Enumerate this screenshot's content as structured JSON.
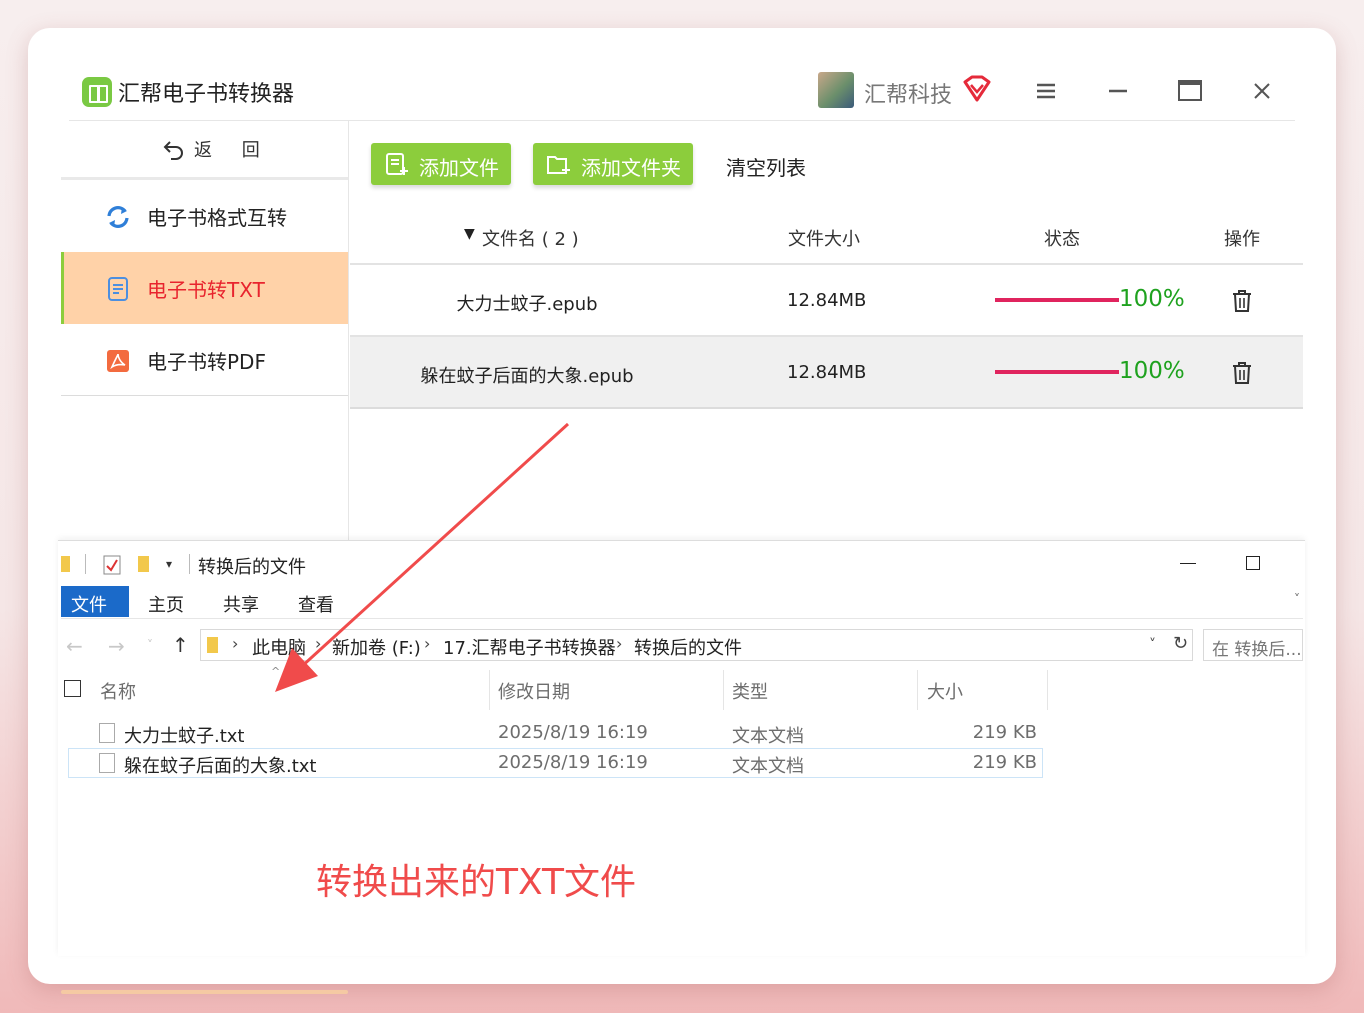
{
  "app": {
    "title": "汇帮电子书转换器",
    "user_name": "汇帮科技",
    "accent_green": "#8ccd3c",
    "brand_red": "#e0245e"
  },
  "sidebar": {
    "back_label": "返 回",
    "items": [
      {
        "label": "电子书格式互转",
        "icon": "refresh-icon",
        "active": false
      },
      {
        "label": "电子书转TXT",
        "icon": "document-icon",
        "active": true
      },
      {
        "label": "电子书转PDF",
        "icon": "pdf-icon",
        "active": false
      }
    ]
  },
  "toolbar": {
    "add_file": "添加文件",
    "add_folder": "添加文件夹",
    "clear_list": "清空列表"
  },
  "table": {
    "headers": {
      "name": "文件名 ( 2 )",
      "size": "文件大小",
      "status": "状态",
      "action": "操作"
    },
    "rows": [
      {
        "name": "大力士蚊子.epub",
        "size": "12.84MB",
        "progress": 1.0,
        "progress_label": "100%"
      },
      {
        "name": "躲在蚊子后面的大象.epub",
        "size": "12.84MB",
        "progress": 1.0,
        "progress_label": "100%"
      }
    ]
  },
  "explorer": {
    "window_title": "转换后的文件",
    "ribbon_tabs": [
      "文件",
      "主页",
      "共享",
      "查看"
    ],
    "path": [
      "此电脑",
      "新加卷 (F:)",
      "17.汇帮电子书转换器",
      "转换后的文件"
    ],
    "search_placeholder": "在 转换后...",
    "columns": {
      "name": "名称",
      "modified": "修改日期",
      "type": "类型",
      "size": "大小"
    },
    "files": [
      {
        "name": "大力士蚊子.txt",
        "modified": "2025/8/19 16:19",
        "type": "文本文档",
        "size": "219 KB"
      },
      {
        "name": "躲在蚊子后面的大象.txt",
        "modified": "2025/8/19 16:19",
        "type": "文本文档",
        "size": "219 KB"
      }
    ]
  },
  "annotation": {
    "text": "转换出来的TXT文件",
    "color": "#f04b4b"
  }
}
